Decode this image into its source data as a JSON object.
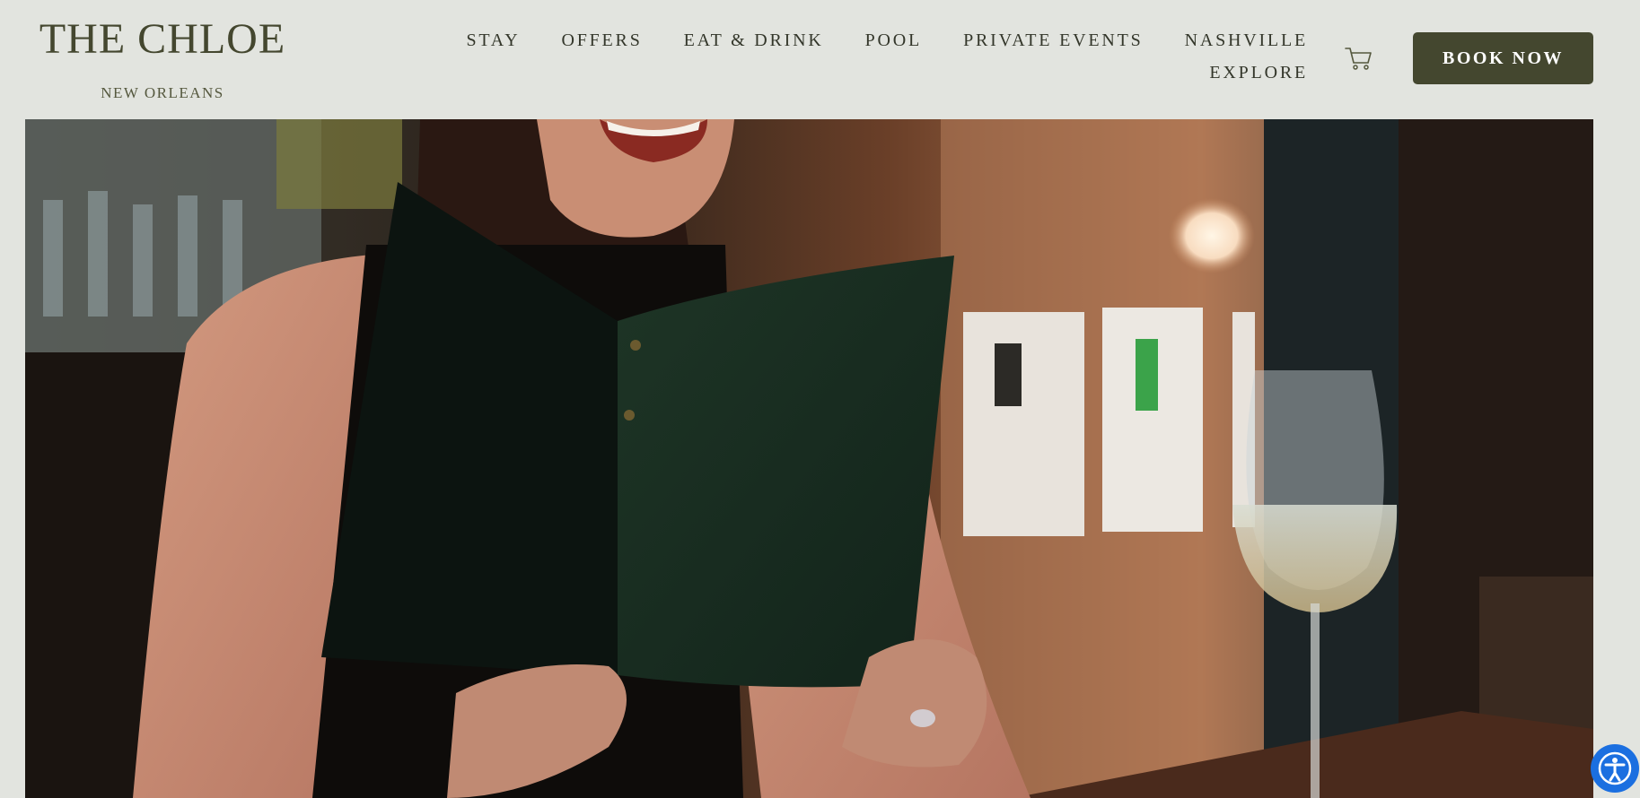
{
  "brand": {
    "title": "THE CHLOE",
    "subtitle": "NEW ORLEANS"
  },
  "nav": {
    "row1": [
      "STAY",
      "OFFERS",
      "EAT & DRINK",
      "POOL",
      "PRIVATE EVENTS",
      "NASHVILLE"
    ],
    "row2": [
      "EXPLORE"
    ]
  },
  "cart": {
    "icon": "cart-icon"
  },
  "cta": {
    "book_label": "BOOK NOW"
  },
  "hero": {
    "image": "woman-laughing-reading-menu-with-wine-glass"
  },
  "accessibility": {
    "icon": "accessibility-icon"
  },
  "colors": {
    "background": "#e2e4df",
    "brand": "#44472f",
    "accessibility": "#1b6fe0"
  }
}
